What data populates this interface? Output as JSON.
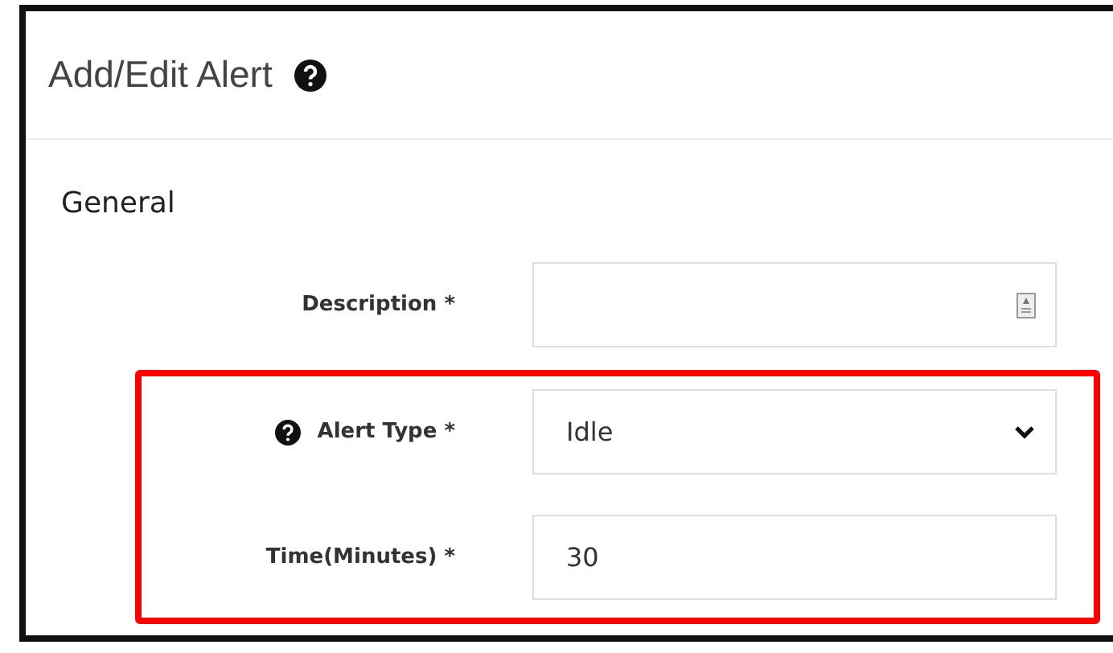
{
  "window": {
    "title": "Add/Edit Alert"
  },
  "section": {
    "title": "General"
  },
  "fields": [
    {
      "kind": "text",
      "label": "Description *",
      "has_help": false
    }
  ],
  "highlighted_fields": [
    {
      "kind": "select",
      "label": "Alert Type *",
      "value": "Idle",
      "has_help": true
    },
    {
      "kind": "text",
      "label": "Time(Minutes) *",
      "value": "30",
      "has_help": false
    }
  ]
}
